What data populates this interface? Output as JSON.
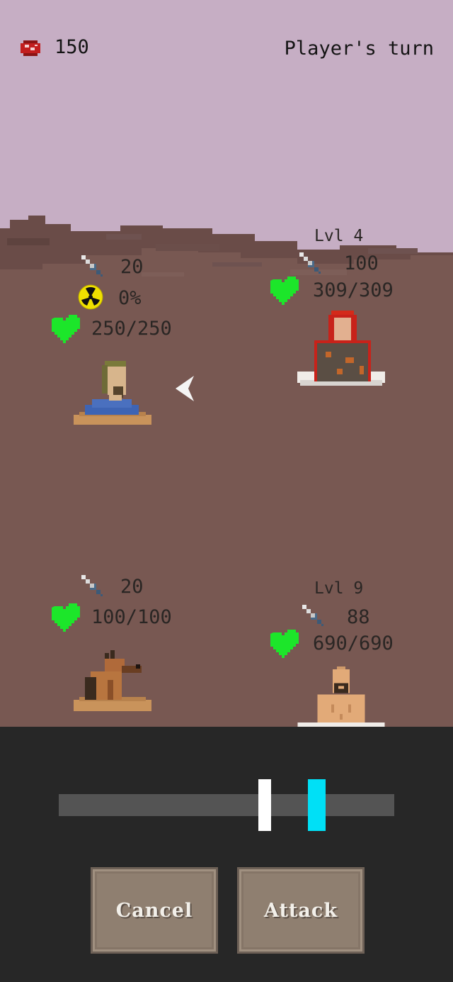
{
  "topbar": {
    "currency_icon": "meat-steak-icon",
    "currency_amount": "150",
    "turn_text": "Player's turn"
  },
  "player_party": [
    {
      "name": "survivor",
      "attack": "20",
      "radiation": "0%",
      "health": "250/250",
      "selected": true
    },
    {
      "name": "dog",
      "attack": "20",
      "health": "100/100"
    }
  ],
  "enemies": [
    {
      "name": "red-haired-raider",
      "level": "Lvl 4",
      "attack": "100",
      "health": "309/309"
    },
    {
      "name": "bald-raider",
      "level": "Lvl 9",
      "attack": "88",
      "health": "690/690"
    }
  ],
  "attack_meter": {
    "marker_position": 0.614,
    "target_position": 0.768
  },
  "actions": {
    "cancel_label": "Cancel",
    "attack_label": "Attack"
  },
  "colors": {
    "sky": "#c6aec4",
    "ground": "#785852",
    "heart": "#1ce62a",
    "target": "#00e0f6",
    "panel": "#272727"
  }
}
